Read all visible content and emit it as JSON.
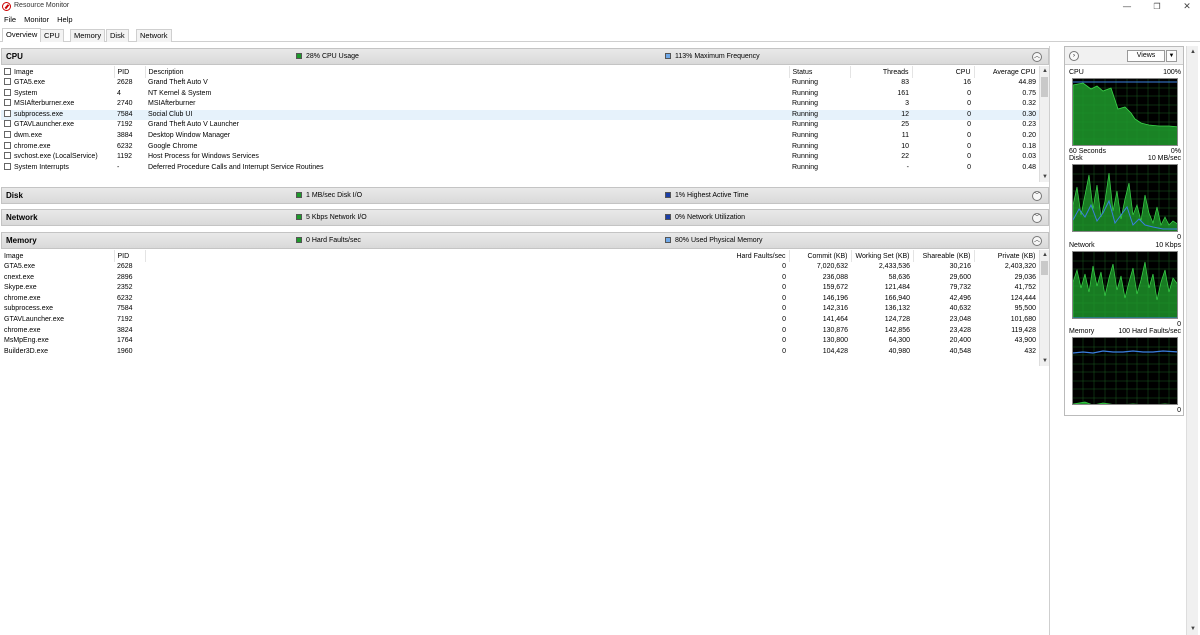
{
  "window": {
    "title": "Resource Monitor",
    "min": "—",
    "max": "❐",
    "close": "✕"
  },
  "menu": [
    "File",
    "Monitor",
    "Help"
  ],
  "tabs": [
    "Overview",
    "CPU",
    "Memory",
    "Disk",
    "Network"
  ],
  "colors": {
    "green": "#1e9a2b",
    "blue": "#6fa8e8",
    "darkblue": "#1b3fa8",
    "graph_green": "#1e9a2b",
    "graph_blue": "#3b7fe0"
  },
  "cpu": {
    "title": "CPU",
    "legend1": "28% CPU Usage",
    "legend2": "113% Maximum Frequency",
    "columns": [
      "Image",
      "PID",
      "Description",
      "Status",
      "Threads",
      "CPU",
      "Average CPU"
    ],
    "rows": [
      [
        "GTA5.exe",
        "2628",
        "Grand Theft Auto V",
        "Running",
        "83",
        "16",
        "44.89"
      ],
      [
        "System",
        "4",
        "NT Kernel & System",
        "Running",
        "161",
        "0",
        "0.75"
      ],
      [
        "MSIAfterburner.exe",
        "2740",
        "MSIAfterburner",
        "Running",
        "3",
        "0",
        "0.32"
      ],
      [
        "subprocess.exe",
        "7584",
        "Social Club UI",
        "Running",
        "12",
        "0",
        "0.30"
      ],
      [
        "GTAVLauncher.exe",
        "7192",
        "Grand Theft Auto V Launcher",
        "Running",
        "25",
        "0",
        "0.23"
      ],
      [
        "dwm.exe",
        "3884",
        "Desktop Window Manager",
        "Running",
        "11",
        "0",
        "0.20"
      ],
      [
        "chrome.exe",
        "6232",
        "Google Chrome",
        "Running",
        "10",
        "0",
        "0.18"
      ],
      [
        "svchost.exe (LocalService)",
        "1192",
        "Host Process for Windows Services",
        "Running",
        "22",
        "0",
        "0.03"
      ],
      [
        "System Interrupts",
        "-",
        "Deferred Procedure Calls and Interrupt Service Routines",
        "Running",
        "-",
        "0",
        "0.48"
      ]
    ]
  },
  "disk": {
    "title": "Disk",
    "legend1": "1 MB/sec Disk I/O",
    "legend2": "1% Highest Active Time"
  },
  "network": {
    "title": "Network",
    "legend1": "5 Kbps Network I/O",
    "legend2": "0% Network Utilization"
  },
  "memory": {
    "title": "Memory",
    "legend1": "0 Hard Faults/sec",
    "legend2": "80% Used Physical Memory",
    "columns": [
      "Image",
      "PID",
      "Hard Faults/sec",
      "Commit (KB)",
      "Working Set (KB)",
      "Shareable (KB)",
      "Private (KB)"
    ],
    "rows": [
      [
        "GTA5.exe",
        "2628",
        "0",
        "7,020,632",
        "2,433,536",
        "30,216",
        "2,403,320"
      ],
      [
        "cnext.exe",
        "2896",
        "0",
        "236,088",
        "58,636",
        "29,600",
        "29,036"
      ],
      [
        "Skype.exe",
        "2352",
        "0",
        "159,672",
        "121,484",
        "79,732",
        "41,752"
      ],
      [
        "chrome.exe",
        "6232",
        "0",
        "146,196",
        "166,940",
        "42,496",
        "124,444"
      ],
      [
        "subprocess.exe",
        "7584",
        "0",
        "142,316",
        "136,132",
        "40,632",
        "95,500"
      ],
      [
        "GTAVLauncher.exe",
        "7192",
        "0",
        "141,464",
        "124,728",
        "23,048",
        "101,680"
      ],
      [
        "chrome.exe",
        "3824",
        "0",
        "130,876",
        "142,856",
        "23,428",
        "119,428"
      ],
      [
        "MsMpEng.exe",
        "1764",
        "0",
        "130,800",
        "64,300",
        "20,400",
        "43,900"
      ],
      [
        "Builder3D.exe",
        "1960",
        "0",
        "104,428",
        "40,980",
        "40,548",
        "432"
      ]
    ]
  },
  "side": {
    "views": "Views",
    "graphs": [
      {
        "label": "CPU",
        "max": "100%",
        "footer_l": "60 Seconds",
        "footer_r": "0%"
      },
      {
        "label": "Disk",
        "max": "10 MB/sec",
        "footer_l": "",
        "footer_r": "0"
      },
      {
        "label": "Network",
        "max": "10 Kbps",
        "footer_l": "",
        "footer_r": "0"
      },
      {
        "label": "Memory",
        "max": "100 Hard Faults/sec",
        "footer_l": "",
        "footer_r": "0"
      }
    ]
  }
}
